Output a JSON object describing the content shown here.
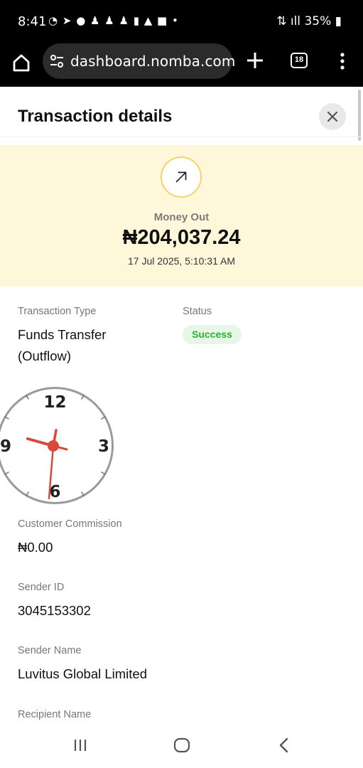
{
  "status_bar": {
    "time": "8:41",
    "notification_icons": [
      "whatsapp-icon",
      "telegram-icon",
      "facebook-icon",
      "snapchat-icon",
      "snapchat-icon",
      "snapchat-icon",
      "sim-icon",
      "warning-icon",
      "app-icon",
      "dot-icon"
    ],
    "battery": "35%"
  },
  "browser": {
    "url": "dashboard.nomba.com",
    "tab_count": "18"
  },
  "panel": {
    "title": "Transaction details"
  },
  "hero": {
    "label": "Money Out",
    "amount": "₦204,037.24",
    "datetime": "17 Jul 2025, 5:10:31 AM",
    "accent": "#fff7d9"
  },
  "fields": {
    "transaction_type": {
      "label": "Transaction Type",
      "value_line1": "Funds Transfer",
      "value_line2": "(Outflow)"
    },
    "status": {
      "label": "Status",
      "value": "Success",
      "color": "#2ab02a"
    },
    "customer_commission": {
      "label": "Customer Commission",
      "value": "₦0.00"
    },
    "sender_id": {
      "label": "Sender ID",
      "value": "3045153302"
    },
    "sender_name": {
      "label": "Sender Name",
      "value": "Luvitus Global Limited"
    },
    "recipient_name": {
      "label": "Recipient Name"
    }
  },
  "clock_overlay": {
    "numerals": [
      "12",
      "3",
      "6",
      "9"
    ],
    "hand_color": "#d9483b"
  }
}
